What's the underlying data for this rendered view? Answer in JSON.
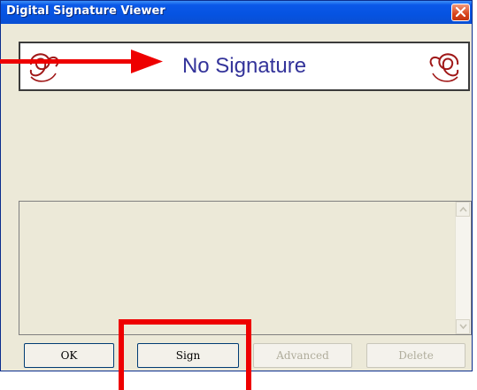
{
  "window": {
    "title": "Digital Signature Viewer",
    "close_icon": "close-icon"
  },
  "signature": {
    "status_text": "No Signature",
    "left_decoration": "swirl-icon",
    "right_decoration": "swirl-icon"
  },
  "details_list": {
    "items": [],
    "scroll_up_icon": "scroll-up-arrow-icon",
    "scroll_down_icon": "scroll-down-arrow-icon"
  },
  "buttons": {
    "ok_label": "OK",
    "sign_label": "Sign",
    "advanced_label": "Advanced",
    "delete_label": "Delete"
  },
  "colors": {
    "titlebar": "#0653e1",
    "window_bg": "#ece9d8",
    "signature_text": "#33339a",
    "annotation": "#ee0000"
  }
}
